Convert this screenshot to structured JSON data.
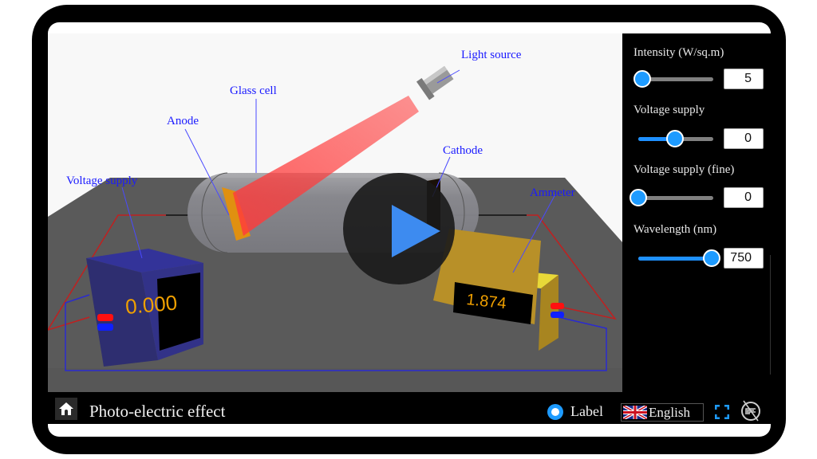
{
  "app": {
    "title": "Photo-electric effect"
  },
  "scene": {
    "labels": {
      "light_source": "Light source",
      "glass_cell": "Glass cell",
      "anode": "Anode",
      "cathode": "Cathode",
      "voltage_supply": "Voltage supply",
      "ammeter": "Ammeter"
    },
    "voltmeter_reading": "0.000",
    "ammeter_reading": "1.874",
    "light_color": "#ff3b3b",
    "play_button": "play-icon"
  },
  "controls": [
    {
      "label": "Intensity (W/sq.m)",
      "value": "5",
      "fraction": 0.0
    },
    {
      "label": "Voltage supply",
      "value": "0",
      "fraction": 0.5
    },
    {
      "label": "Voltage supply (fine)",
      "value": "0",
      "fraction": 0.0
    },
    {
      "label": "Wavelength (nm)",
      "value": "750",
      "fraction": 1.0
    }
  ],
  "bottom_bar": {
    "label_toggle": "Label",
    "language": "English",
    "home_icon": "home-icon",
    "fullscreen_icon": "fullscreen-icon",
    "hide_panel_icon": "hide-panel-icon"
  },
  "colors": {
    "accent": "#1e9bff",
    "label_blue": "#1a1aff",
    "display_digits": "#f0a000"
  }
}
